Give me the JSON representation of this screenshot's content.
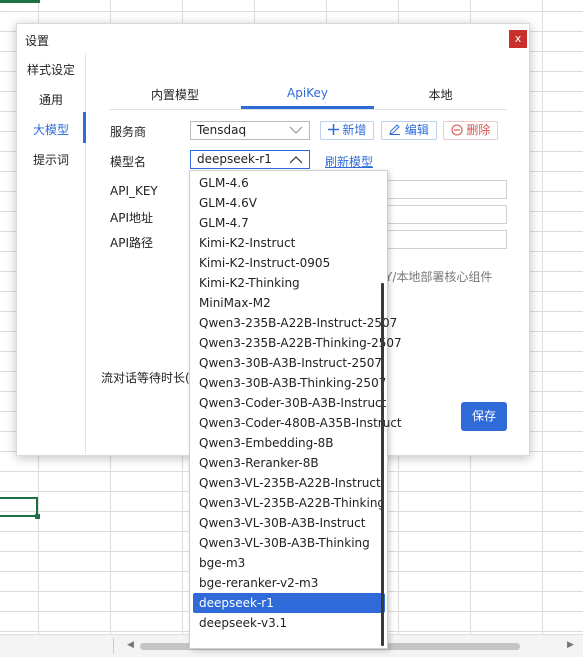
{
  "dialog": {
    "title": "设置",
    "close": "x",
    "nav": [
      "样式设定",
      "通用",
      "大模型",
      "提示词"
    ],
    "tabs": [
      "内置模型",
      "ApiKey",
      "本地"
    ],
    "provider_label": "服务商",
    "provider_value": "Tensdaq",
    "add_label": "新增",
    "edit_label": "编辑",
    "delete_label": "删除",
    "model_label": "模型名",
    "model_value": "deepseek-r1",
    "refresh_label": "刷新模型",
    "api_key_label": "API_KEY",
    "api_addr_label": "API地址",
    "api_path_label": "API路径",
    "hint": "Y/本地部署核心组件",
    "stream_label": "流对话等待时长(",
    "save_label": "保存"
  },
  "dropdown": {
    "options": [
      "GLM-4.6",
      "GLM-4.6V",
      "GLM-4.7",
      "Kimi-K2-Instruct",
      "Kimi-K2-Instruct-0905",
      "Kimi-K2-Thinking",
      "MiniMax-M2",
      "Qwen3-235B-A22B-Instruct-2507",
      "Qwen3-235B-A22B-Thinking-2507",
      "Qwen3-30B-A3B-Instruct-2507",
      "Qwen3-30B-A3B-Thinking-2507",
      "Qwen3-Coder-30B-A3B-Instruct",
      "Qwen3-Coder-480B-A35B-Instruct",
      "Qwen3-Embedding-8B",
      "Qwen3-Reranker-8B",
      "Qwen3-VL-235B-A22B-Instruct",
      "Qwen3-VL-235B-A22B-Thinking",
      "Qwen3-VL-30B-A3B-Instruct",
      "Qwen3-VL-30B-A3B-Thinking",
      "bge-m3",
      "bge-reranker-v2-m3",
      "deepseek-r1",
      "deepseek-v3.1"
    ],
    "selected": "deepseek-r1"
  },
  "colors": {
    "accent": "#2f6bd8",
    "danger": "#d9534f",
    "sheet_select": "#1e7145"
  }
}
